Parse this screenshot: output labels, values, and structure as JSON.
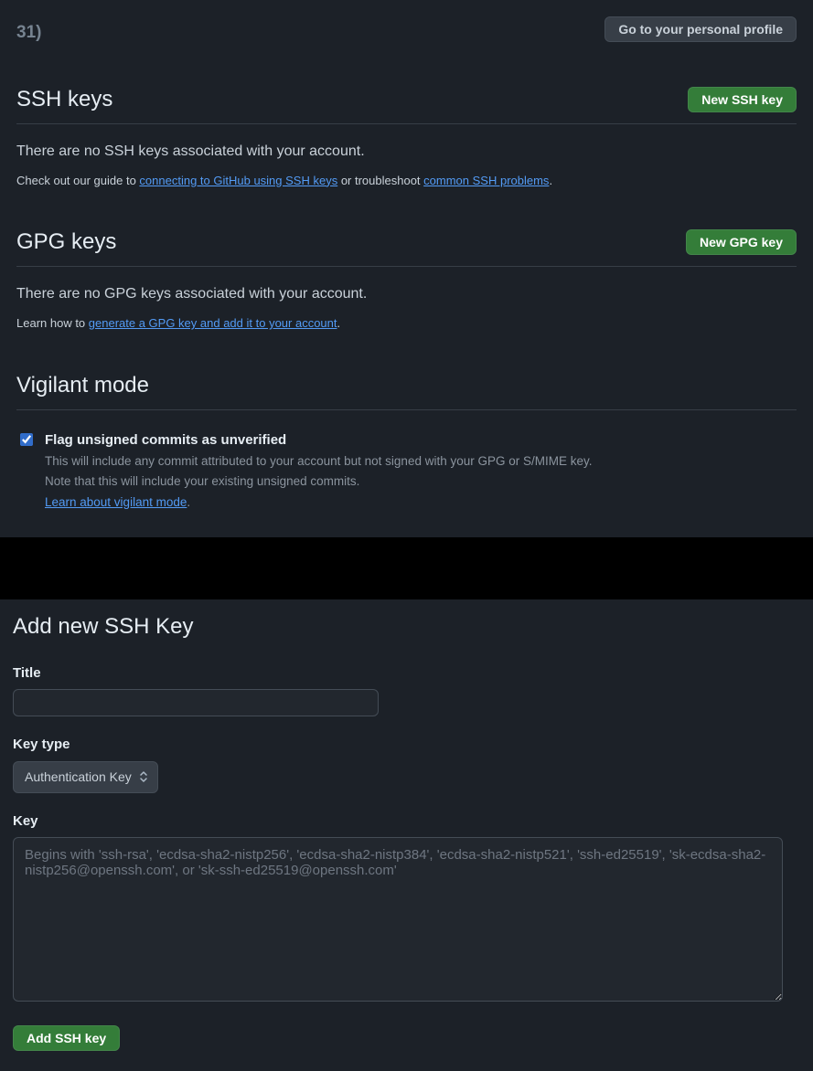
{
  "top": {
    "fragment": "31)",
    "profile_button": "Go to your personal profile"
  },
  "ssh": {
    "heading": "SSH keys",
    "new_button": "New SSH key",
    "empty": "There are no SSH keys associated with your account.",
    "guide_prefix": "Check out our guide to ",
    "guide_link": "connecting to GitHub using SSH keys",
    "guide_mid": " or troubleshoot ",
    "guide_link2": "common SSH problems",
    "guide_suffix": "."
  },
  "gpg": {
    "heading": "GPG keys",
    "new_button": "New GPG key",
    "empty": "There are no GPG keys associated with your account.",
    "guide_prefix": "Learn how to ",
    "guide_link": "generate a GPG key and add it to your account",
    "guide_suffix": "."
  },
  "vigilant": {
    "heading": "Vigilant mode",
    "checkbox_label": "Flag unsigned commits as unverified",
    "desc1": "This will include any commit attributed to your account but not signed with your GPG or S/MIME key.",
    "desc2": "Note that this will include your existing unsigned commits.",
    "learn_link": "Learn about vigilant mode",
    "learn_suffix": "."
  },
  "form": {
    "heading": "Add new SSH Key",
    "title_label": "Title",
    "title_value": "",
    "keytype_label": "Key type",
    "keytype_value": "Authentication Key",
    "key_label": "Key",
    "key_placeholder": "Begins with 'ssh-rsa', 'ecdsa-sha2-nistp256', 'ecdsa-sha2-nistp384', 'ecdsa-sha2-nistp521', 'ssh-ed25519', 'sk-ecdsa-sha2-nistp256@openssh.com', or 'sk-ssh-ed25519@openssh.com'",
    "submit": "Add SSH key"
  }
}
